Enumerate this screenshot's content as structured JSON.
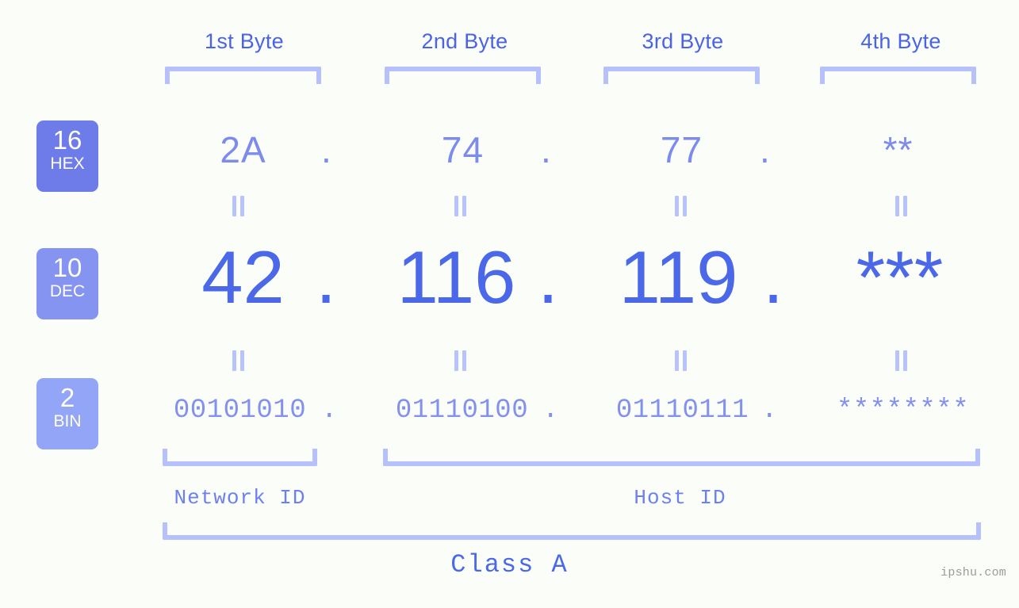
{
  "background": "#fbfdf8",
  "colors": {
    "header_label": "#4a63e7",
    "bracket": "#b6c0fb",
    "hex_value": "#7d8bec",
    "dec_value": "#4a68e8",
    "bin_value": "#8290ee",
    "badge_hex": "#6d7ce9",
    "badge_dec": "#8494f0",
    "badge_bin": "#92a5f6",
    "id_label": "#6d80ef",
    "class_label": "#4a68e8",
    "watermark": "#9b9b9b"
  },
  "byte_headers": [
    {
      "label": "1st Byte"
    },
    {
      "label": "2nd Byte"
    },
    {
      "label": "3rd Byte"
    },
    {
      "label": "4th Byte"
    }
  ],
  "bases": [
    {
      "number": "16",
      "name": "HEX"
    },
    {
      "number": "10",
      "name": "DEC"
    },
    {
      "number": "2",
      "name": "BIN"
    }
  ],
  "rows": {
    "hex": {
      "base_number": "16",
      "base_name": "HEX",
      "values": [
        "2A",
        "74",
        "77",
        "**"
      ],
      "separator": "."
    },
    "dec": {
      "base_number": "10",
      "base_name": "DEC",
      "values": [
        "42",
        "116",
        "119",
        "***"
      ],
      "separator": "."
    },
    "bin": {
      "base_number": "2",
      "base_name": "BIN",
      "values": [
        "00101010",
        "01110100",
        "01110111",
        "********"
      ],
      "separator": "."
    }
  },
  "equals_symbol": "=",
  "id_sections": [
    {
      "label": "Network ID"
    },
    {
      "label": "Host ID"
    }
  ],
  "class": {
    "label": "Class A"
  },
  "watermark": "ipshu.com"
}
